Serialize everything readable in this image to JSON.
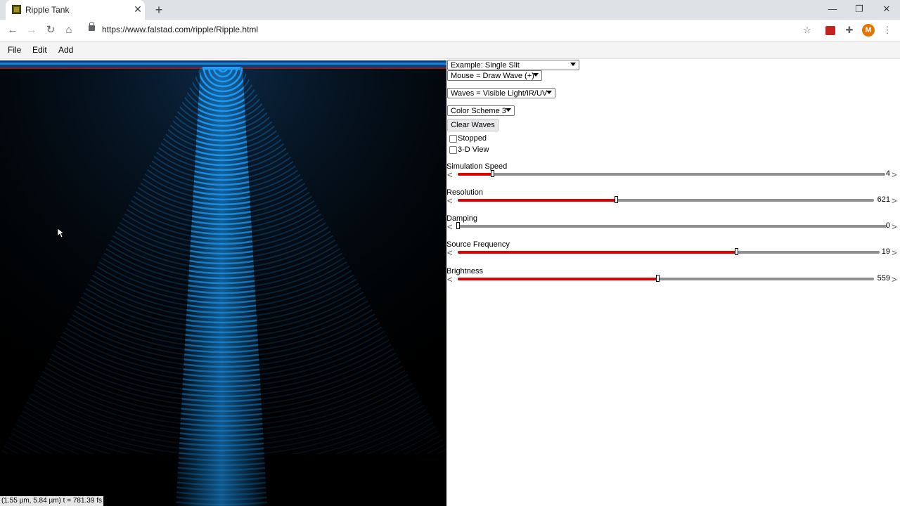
{
  "browser": {
    "tab_title": "Ripple Tank",
    "new_tab_symbol": "+",
    "url": "https://www.falstad.com/ripple/Ripple.html",
    "avatar_letter": "M",
    "window_controls": {
      "minimize": "—",
      "maximize": "❐",
      "close": "✕"
    },
    "nav": {
      "back": "←",
      "forward": "→",
      "reload": "↻",
      "home": "⌂",
      "star": "☆",
      "extensions": "✚",
      "menu": "⋮"
    }
  },
  "menubar": {
    "file": "File",
    "edit": "Edit",
    "add": "Add"
  },
  "simulation": {
    "coords_readout": "(1.55 µm, 5.84 µm) t = 781.39 fs",
    "wave_color": "#1ea0ff"
  },
  "controls": {
    "example_select": "Example: Single Slit",
    "mouse_select": "Mouse = Draw Wave (+)",
    "waves_select": "Waves = Visible Light/IR/UV",
    "color_scheme_select": "Color Scheme 3",
    "clear_button": "Clear Waves",
    "stopped": {
      "label": "Stopped",
      "checked": false
    },
    "view3d": {
      "label": "3-D View",
      "checked": false
    }
  },
  "sliders": [
    {
      "id": "speed",
      "label": "Simulation Speed",
      "value": "4",
      "fraction": 0.08
    },
    {
      "id": "resolution",
      "label": "Resolution",
      "value": "621",
      "fraction": 0.38
    },
    {
      "id": "damping",
      "label": "Damping",
      "value": "0",
      "fraction": 0.0
    },
    {
      "id": "frequency",
      "label": "Source Frequency",
      "value": "19",
      "fraction": 0.66
    },
    {
      "id": "brightness",
      "label": "Brightness",
      "value": "559",
      "fraction": 0.48
    }
  ],
  "slider_arrows": {
    "left": "<",
    "right": ">"
  },
  "colors": {
    "slider_fill": "#e00000",
    "slider_track": "#8f8f8f",
    "tab_strip": "#dee1e6",
    "avatar": "#e37400"
  }
}
